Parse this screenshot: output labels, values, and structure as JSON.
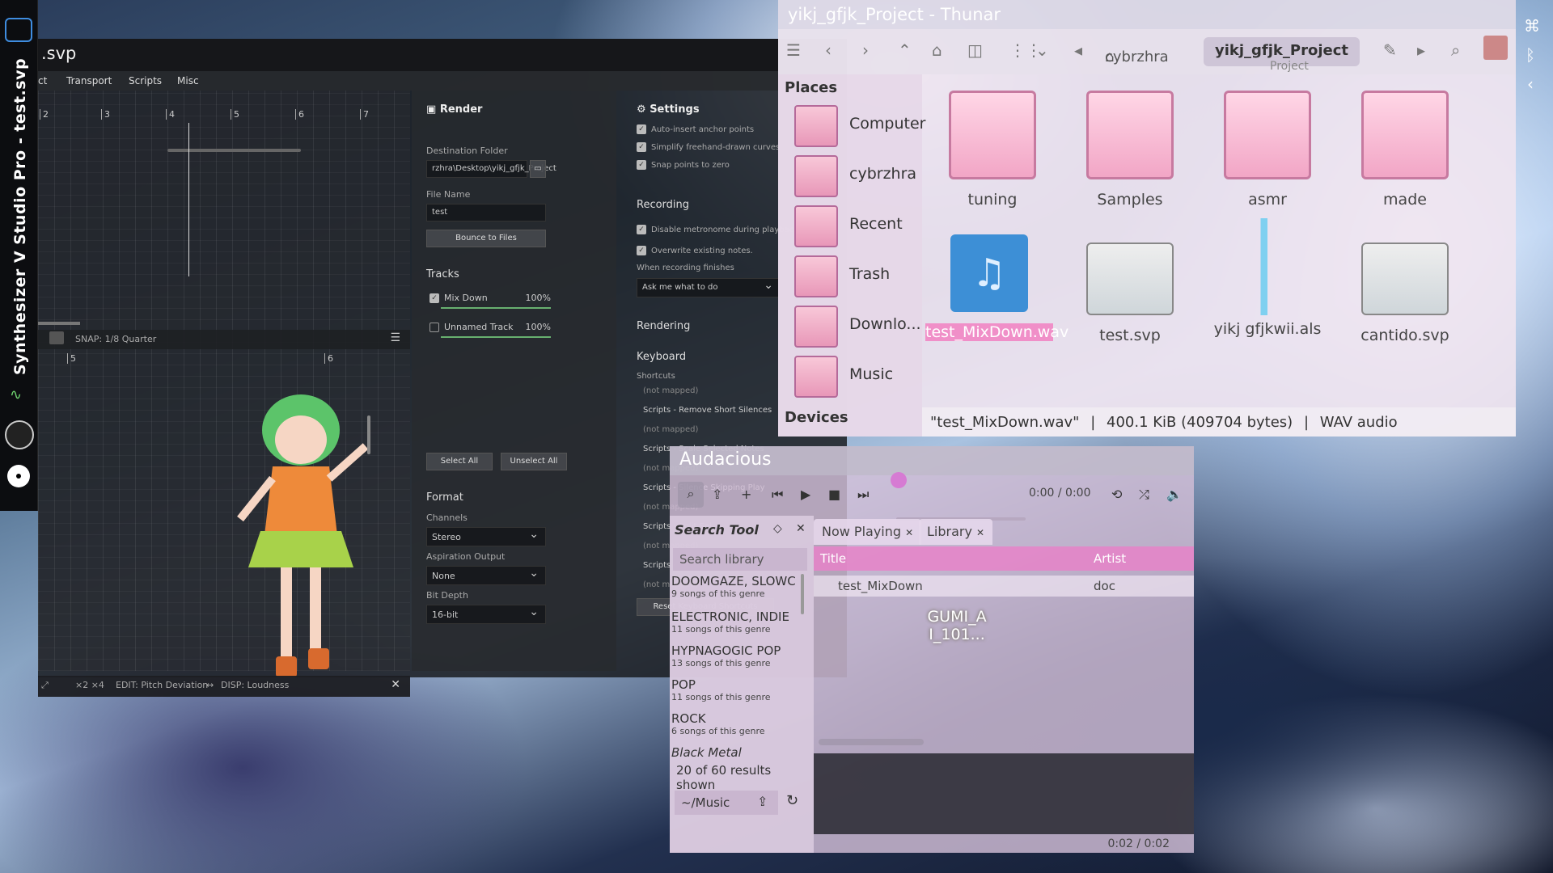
{
  "dock": {
    "vertical_title": "Synthesizer V Studio Pro - test.svp"
  },
  "synth": {
    "title": ".svp",
    "menu": [
      "ct",
      "Transport",
      "Scripts",
      "Misc"
    ],
    "ruler": [
      "2",
      "3",
      "4",
      "5",
      "6",
      "7"
    ],
    "snap": "SNAP:  1/8 Quarter",
    "ruler2": [
      "5",
      "6"
    ],
    "edit_bar": {
      "mults": "×2  ×4",
      "edit": "EDIT:  Pitch Deviation",
      "disp": "DISP:  Loudness"
    },
    "render": {
      "heading": "Render",
      "dest_label": "Destination Folder",
      "dest_value": "rzhra\\Desktop\\yikj_gfjk_Project",
      "file_label": "File Name",
      "file_value": "test",
      "bounce": "Bounce to Files",
      "tracks_heading": "Tracks",
      "tracks": [
        {
          "name": "Mix Down",
          "pct": "100%",
          "checked": true
        },
        {
          "name": "Unnamed Track",
          "pct": "100%",
          "checked": false
        }
      ],
      "select_all": "Select All",
      "unselect_all": "Unselect All",
      "format_heading": "Format",
      "channels_label": "Channels",
      "channels_value": "Stereo",
      "aspiration_label": "Aspiration Output",
      "aspiration_value": "None",
      "bitdepth_label": "Bit Depth",
      "bitdepth_value": "16-bit"
    },
    "settings": {
      "heading": "Settings",
      "opts1": [
        "Auto-insert anchor points",
        "Simplify freehand-drawn curves",
        "Snap points to zero"
      ],
      "recording_heading": "Recording",
      "opts2": [
        "Disable metronome during playback.",
        "Overwrite existing notes."
      ],
      "when_label": "When recording finishes",
      "when_value": "Ask me what to do",
      "rendering_heading": "Rendering",
      "keyboard_heading": "Keyboard",
      "shortcuts_label": "Shortcuts",
      "not_mapped": "(not mapped)",
      "scripts": [
        "Scripts - Remove Short Silences",
        "Scripts - Scale Selected Notes",
        "Scripts - Silence Skipping Play",
        "Scripts - Split Sel",
        "Scripts - Split Sel"
      ],
      "reset": "Reset Keyboard Shortcuts"
    }
  },
  "thunar": {
    "title": "yikj_gfjk_Project - Thunar",
    "crumb_home": "cybrzhra",
    "crumb_current": "yikj_gfjk_Project",
    "crumb_overflow": "Project",
    "places_heading": "Places",
    "places": [
      "Computer",
      "cybrzhra",
      "Recent",
      "Trash",
      "Downlo...",
      "Music"
    ],
    "devices_heading": "Devices",
    "items": [
      {
        "name": "tuning",
        "kind": "folder"
      },
      {
        "name": "Samples",
        "kind": "folder"
      },
      {
        "name": "asmr",
        "kind": "folder"
      },
      {
        "name": "made",
        "kind": "folder"
      },
      {
        "name": "test_MixDown.wav",
        "kind": "audio"
      },
      {
        "name": "test.svp",
        "kind": "doc"
      },
      {
        "name": "yikj gfjkwii.als",
        "kind": "als"
      },
      {
        "name": "cantido.svp",
        "kind": "doc"
      }
    ],
    "status": {
      "file": "\"test_MixDown.wav\"",
      "size": "400.1 KiB (409704 bytes)",
      "type": "WAV audio"
    }
  },
  "audacious": {
    "title": "Audacious",
    "time": "0:00 / 0:00",
    "search_tool": "Search Tool",
    "search_placeholder": "Search library",
    "genres": [
      {
        "name": "DOOMGAZE, SLOWC",
        "count": "9 songs of this genre"
      },
      {
        "name": "ELECTRONIC, INDIE",
        "count": "11 songs of this genre"
      },
      {
        "name": "HYPNAGOGIC POP",
        "count": "13 songs of this genre"
      },
      {
        "name": "POP",
        "count": "11 songs of this genre"
      },
      {
        "name": "ROCK",
        "count": "6 songs of this genre"
      },
      {
        "name": "Black Metal",
        "count": ""
      }
    ],
    "results": "20 of 60 results shown",
    "path": "~/Music",
    "tabs": [
      "Now Playing",
      "Library"
    ],
    "columns": {
      "title": "Title",
      "artist": "Artist"
    },
    "rows": [
      {
        "title": "test_MixDown",
        "artist": "doc"
      }
    ],
    "art_label": "GUMI_A\nI_101...",
    "elapsed": "0:02 / 0:02"
  }
}
